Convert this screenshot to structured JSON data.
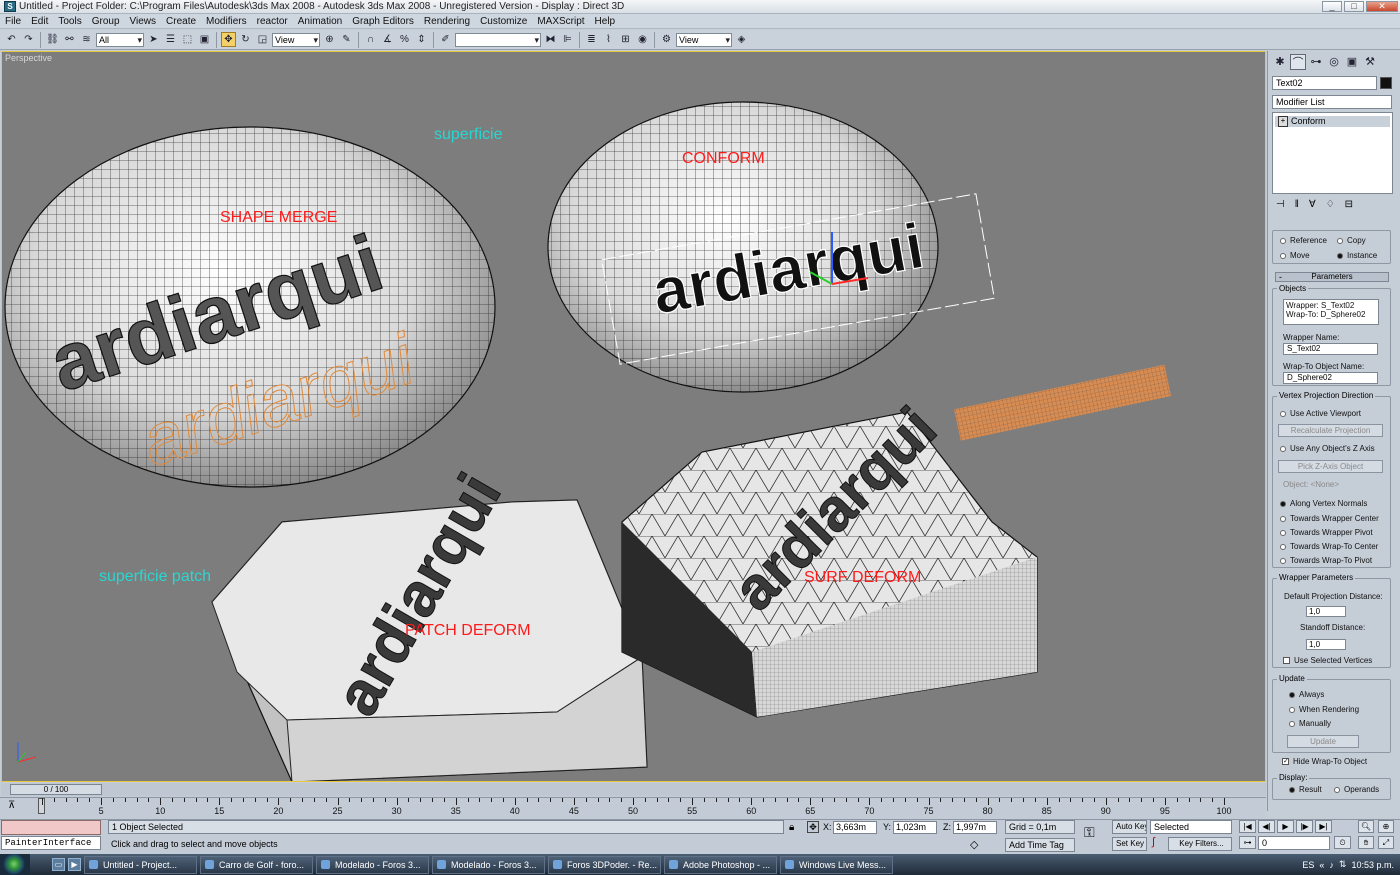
{
  "window": {
    "title": "Untitled    - Project Folder: C:\\Program Files\\Autodesk\\3ds Max 2008    - Autodesk 3ds Max 2008    - Unregistered Version    - Display : Direct 3D"
  },
  "menu": [
    "File",
    "Edit",
    "Tools",
    "Group",
    "Views",
    "Create",
    "Modifiers",
    "reactor",
    "Animation",
    "Graph Editors",
    "Rendering",
    "Customize",
    "MAXScript",
    "Help"
  ],
  "toolbar": {
    "selection_filter": "All",
    "ref_coord": "View",
    "named_selection": "",
    "render_view": "View"
  },
  "viewport": {
    "label": "Perspective",
    "labels": {
      "shape_merge": "SHAPE MERGE",
      "superficie": "superficie",
      "conform": "CONFORM",
      "superficie_patch": "superficie patch",
      "patch_deform": "PATCH DEFORM",
      "surf_deform": "SURF DEFORM"
    },
    "text_object": "ardiarqui"
  },
  "command_panel": {
    "object_name": "Text02",
    "modifier_list": "Modifier List",
    "stack": [
      "Conform"
    ],
    "reference": "Reference",
    "copy": "Copy",
    "move": "Move",
    "instance": "Instance",
    "rollout": "Parameters",
    "objects_group": "Objects",
    "objects_info": [
      "Wrapper: S_Text02",
      "Wrap-To: D_Sphere02"
    ],
    "wrapper_name_label": "Wrapper Name:",
    "wrapper_name": "S_Text02",
    "wrapto_name_label": "Wrap-To Object Name:",
    "wrapto_name": "D_Sphere02",
    "vpd_group": "Vertex Projection Direction",
    "use_active_viewport": "Use Active Viewport",
    "recalculate": "Recalculate Projection",
    "use_any_z": "Use Any Object's Z Axis",
    "pick_z": "Pick Z-Axis Object",
    "object_none": "Object: <None>",
    "along_normals": "Along Vertex Normals",
    "towards_wrapper_center": "Towards Wrapper Center",
    "towards_wrapper_pivot": "Towards Wrapper Pivot",
    "towards_wrapto_center": "Towards Wrap-To Center",
    "towards_wrapto_pivot": "Towards Wrap-To Pivot",
    "wrapper_params_group": "Wrapper Parameters",
    "default_proj_label": "Default Projection Distance:",
    "default_proj_value": "1,0",
    "standoff_label": "Standoff Distance:",
    "standoff_value": "1,0",
    "use_selected_vertices": "Use Selected Vertices",
    "update_group": "Update",
    "always": "Always",
    "when_rendering": "When Rendering",
    "manually": "Manually",
    "update_btn": "Update",
    "hide_wrapto": "Hide Wrap-To Object",
    "display_group": "Display:",
    "result": "Result",
    "operands": "Operands"
  },
  "timeline": {
    "frame_display": "0 / 100",
    "ticks": [
      "5",
      "10",
      "15",
      "20",
      "25",
      "30",
      "35",
      "40",
      "45",
      "50",
      "55",
      "60",
      "65",
      "70",
      "75",
      "80",
      "85",
      "90",
      "95",
      "100"
    ]
  },
  "status": {
    "selected": "1 Object Selected",
    "prompt": "Click and drag to select and move objects",
    "maxscript": "PainterInterface",
    "x_label": "X:",
    "x": "3,663m",
    "y_label": "Y:",
    "y": "1,023m",
    "z_label": "Z:",
    "z": "1,997m",
    "grid": "Grid = 0,1m",
    "add_time_tag": "Add Time Tag",
    "auto_key": "Auto Key",
    "set_key": "Set Key",
    "key_mode": "Selected",
    "key_filters": "Key Filters...",
    "frame": "0"
  },
  "taskbar": {
    "items": [
      "Untitled    - Project...",
      "Carro de Golf - foro...",
      "Modelado - Foros 3...",
      "Modelado - Foros 3...",
      "Foros 3DPoder. - Re...",
      "Adobe Photoshop - ...",
      "Windows Live Mess..."
    ],
    "lang": "ES",
    "clock": "10:53 p.m."
  }
}
